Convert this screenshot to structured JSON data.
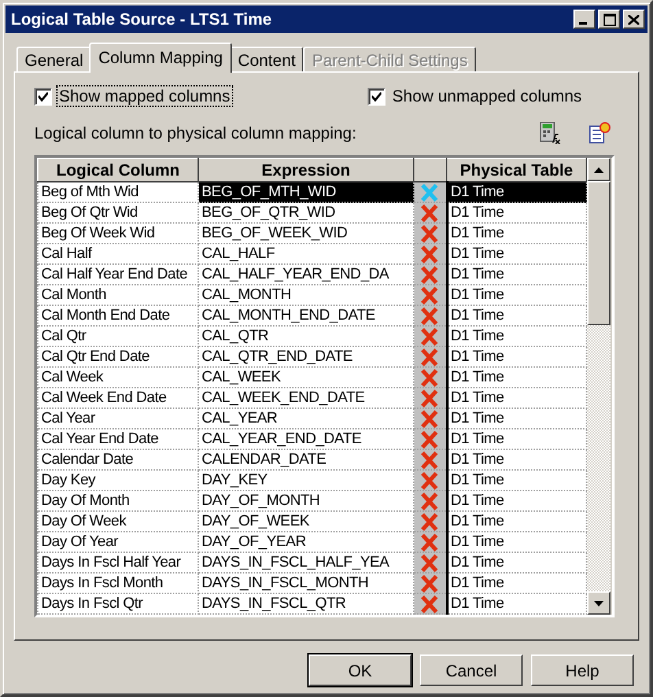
{
  "window": {
    "title": "Logical Table Source - LTS1 Time"
  },
  "tabs": [
    {
      "label": "General",
      "selected": false,
      "disabled": false
    },
    {
      "label": "Column Mapping",
      "selected": true,
      "disabled": false
    },
    {
      "label": "Content",
      "selected": false,
      "disabled": false
    },
    {
      "label": "Parent-Child Settings",
      "selected": false,
      "disabled": true
    }
  ],
  "options": [
    {
      "label": "Show mapped columns",
      "checked": true,
      "focused": true
    },
    {
      "label": "Show unmapped columns",
      "checked": true,
      "focused": false
    }
  ],
  "mapping_label": "Logical column to physical column mapping:",
  "table": {
    "columns": [
      "Logical Column",
      "Expression",
      "Physical Table"
    ],
    "rows": [
      {
        "logical": "Beg of Mth Wid",
        "expression": "BEG_OF_MTH_WID",
        "physical": "D1 Time",
        "selected": true
      },
      {
        "logical": "Beg Of Qtr Wid",
        "expression": "BEG_OF_QTR_WID",
        "physical": "D1 Time",
        "selected": false
      },
      {
        "logical": "Beg Of Week Wid",
        "expression": "BEG_OF_WEEK_WID",
        "physical": "D1 Time",
        "selected": false
      },
      {
        "logical": "Cal Half",
        "expression": "CAL_HALF",
        "physical": "D1 Time",
        "selected": false
      },
      {
        "logical": "Cal Half Year End Date",
        "expression": "CAL_HALF_YEAR_END_DA",
        "physical": "D1 Time",
        "selected": false
      },
      {
        "logical": "Cal Month",
        "expression": "CAL_MONTH",
        "physical": "D1 Time",
        "selected": false
      },
      {
        "logical": "Cal Month End Date",
        "expression": "CAL_MONTH_END_DATE",
        "physical": "D1 Time",
        "selected": false
      },
      {
        "logical": "Cal Qtr",
        "expression": "CAL_QTR",
        "physical": "D1 Time",
        "selected": false
      },
      {
        "logical": "Cal Qtr End Date",
        "expression": "CAL_QTR_END_DATE",
        "physical": "D1 Time",
        "selected": false
      },
      {
        "logical": "Cal Week",
        "expression": "CAL_WEEK",
        "physical": "D1 Time",
        "selected": false
      },
      {
        "logical": "Cal Week End Date",
        "expression": "CAL_WEEK_END_DATE",
        "physical": "D1 Time",
        "selected": false
      },
      {
        "logical": "Cal Year",
        "expression": "CAL_YEAR",
        "physical": "D1 Time",
        "selected": false
      },
      {
        "logical": "Cal Year End Date",
        "expression": "CAL_YEAR_END_DATE",
        "physical": "D1 Time",
        "selected": false
      },
      {
        "logical": "Calendar Date",
        "expression": "CALENDAR_DATE",
        "physical": "D1 Time",
        "selected": false
      },
      {
        "logical": "Day Key",
        "expression": "DAY_KEY",
        "physical": "D1 Time",
        "selected": false
      },
      {
        "logical": "Day Of Month",
        "expression": "DAY_OF_MONTH",
        "physical": "D1 Time",
        "selected": false
      },
      {
        "logical": "Day Of Week",
        "expression": "DAY_OF_WEEK",
        "physical": "D1 Time",
        "selected": false
      },
      {
        "logical": "Day Of Year",
        "expression": "DAY_OF_YEAR",
        "physical": "D1 Time",
        "selected": false
      },
      {
        "logical": "Days In Fscl Half Year",
        "expression": "DAYS_IN_FSCL_HALF_YEA",
        "physical": "D1 Time",
        "selected": false
      },
      {
        "logical": "Days In Fscl Month",
        "expression": "DAYS_IN_FSCL_MONTH",
        "physical": "D1 Time",
        "selected": false
      },
      {
        "logical": "Days In Fscl Qtr",
        "expression": "DAYS_IN_FSCL_QTR",
        "physical": "D1 Time",
        "selected": false
      }
    ]
  },
  "buttons": [
    {
      "label": "OK",
      "default": true
    },
    {
      "label": "Cancel",
      "default": false
    },
    {
      "label": "Help",
      "default": false
    }
  ]
}
